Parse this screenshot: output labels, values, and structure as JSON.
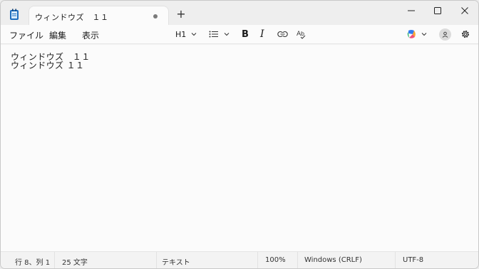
{
  "tab": {
    "title": "ウィンドウズ　１１"
  },
  "menu": {
    "file": "ファイル",
    "edit": "編集",
    "view": "表示"
  },
  "toolbar": {
    "heading": "H1"
  },
  "document": {
    "lines": [
      "ウィンドウズ　１１",
      "ウィンドウズ １１"
    ]
  },
  "status": {
    "position": "行 8、列 1",
    "chars": "25 文字",
    "format": "テキスト",
    "zoom": "100%",
    "line_ending": "Windows (CRLF)",
    "encoding": "UTF-8"
  },
  "colors": {
    "window_bg": "#f3f3f3",
    "editor_bg": "#fbfbfb",
    "text": "#1b1b1b",
    "app_icon": "#1e6fbf"
  }
}
